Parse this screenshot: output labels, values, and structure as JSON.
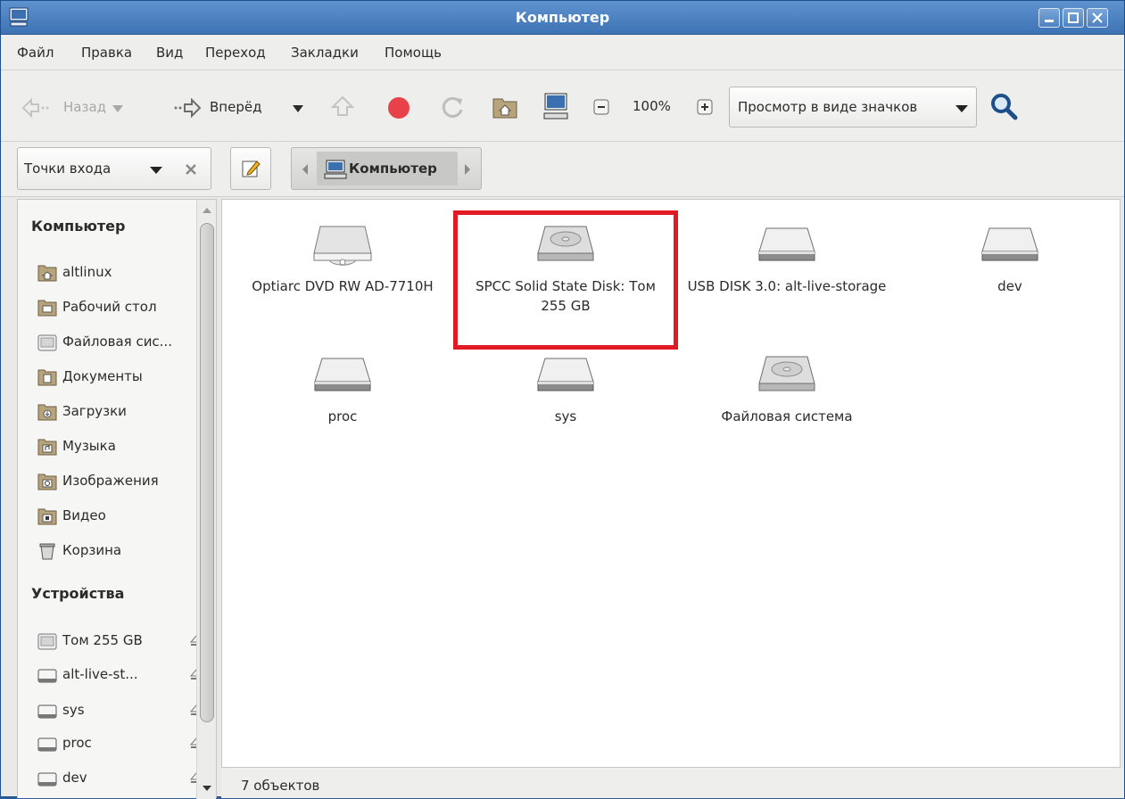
{
  "window": {
    "title": "Компьютер"
  },
  "menu": [
    "Файл",
    "Правка",
    "Вид",
    "Переход",
    "Закладки",
    "Помощь"
  ],
  "toolbar": {
    "back_label": "Назад",
    "forward_label": "Вперёд",
    "zoom": "100%",
    "view_mode": "Просмотр в виде значков"
  },
  "location": {
    "places_label": "Точки входа",
    "breadcrumb": "Компьютер"
  },
  "sidebar": {
    "computer_header": "Компьютер",
    "computer_items": [
      {
        "label": "altlinux",
        "icon": "home-folder-icon"
      },
      {
        "label": "Рабочий стол",
        "icon": "desktop-folder-icon"
      },
      {
        "label": "Файловая сис...",
        "icon": "filesystem-icon"
      },
      {
        "label": "Документы",
        "icon": "documents-folder-icon"
      },
      {
        "label": "Загрузки",
        "icon": "downloads-folder-icon"
      },
      {
        "label": "Музыка",
        "icon": "music-folder-icon"
      },
      {
        "label": "Изображения",
        "icon": "pictures-folder-icon"
      },
      {
        "label": "Видео",
        "icon": "videos-folder-icon"
      },
      {
        "label": "Корзина",
        "icon": "trash-icon"
      }
    ],
    "devices_header": "Устройства",
    "device_items": [
      {
        "label": "Том 255 GB",
        "icon": "harddisk-icon"
      },
      {
        "label": "alt-live-st...",
        "icon": "drive-icon"
      },
      {
        "label": "sys",
        "icon": "drive-icon"
      },
      {
        "label": "proc",
        "icon": "drive-icon"
      },
      {
        "label": "dev",
        "icon": "drive-icon"
      }
    ]
  },
  "items": [
    {
      "label": "Optiarc DVD RW AD-7710H",
      "icon": "optical-drive-icon"
    },
    {
      "label": "SPCC Solid State Disk: Том 255 GB",
      "icon": "harddisk-icon",
      "highlighted": true
    },
    {
      "label": "USB DISK 3.0: alt-live-storage",
      "icon": "drive-icon"
    },
    {
      "label": "dev",
      "icon": "drive-icon"
    },
    {
      "label": "proc",
      "icon": "drive-icon"
    },
    {
      "label": "sys",
      "icon": "drive-icon"
    },
    {
      "label": "Файловая система",
      "icon": "harddisk-icon"
    }
  ],
  "status": {
    "count": "7 объектов"
  },
  "colors": {
    "titlebar": "#3d72b4",
    "highlight": "#e21a23",
    "stop": "#e8414a"
  }
}
